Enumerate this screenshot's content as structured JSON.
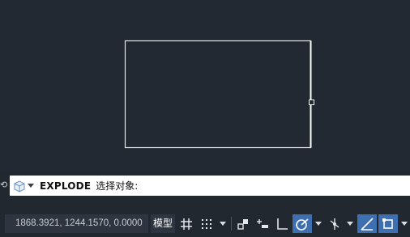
{
  "drawing": {
    "line_color": "#e6e9ec",
    "grip_color": "#ffffff"
  },
  "command_line": {
    "icon": "cube-icon",
    "command": "EXPLODE",
    "prompt": "选择对象:"
  },
  "status_bar": {
    "coordinates": "1868.3921, 1244.1570, 0.0000",
    "model_label": "模型",
    "tools": [
      "grid-icon",
      "snap-grid-icon",
      "snap-dropdown-caret",
      "infer-constraints-icon",
      "dynamic-input-icon",
      "ortho-icon",
      "polar-tracking-icon",
      "polar-dropdown-caret",
      "isodraft-icon",
      "isodraft-dropdown-caret",
      "object-snap-tracking-icon",
      "object-snap-icon",
      "object-snap-dropdown-caret"
    ],
    "active_color": "#3e6fb0"
  }
}
